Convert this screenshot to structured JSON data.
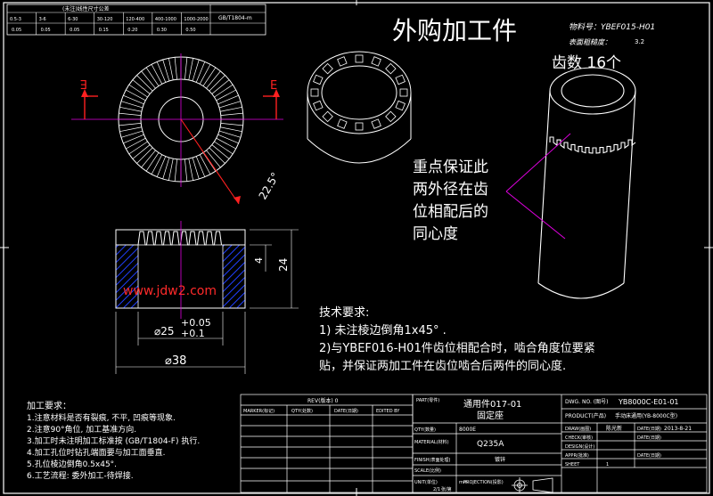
{
  "tolerance_table": {
    "title": "(未注)线性尺寸公差",
    "std": "GB/T1804-m",
    "ranges": [
      "0.5-3",
      "3-6",
      "6-30",
      "30-120",
      "120-400",
      "400-1000",
      "1000-2000"
    ],
    "values": [
      "0.05",
      "0.05",
      "0.05",
      "0.15",
      "0.20",
      "0.30",
      "0.50"
    ]
  },
  "title_main": "外购加工件",
  "code_line": "物料号：YBEF015-H01",
  "roughness_line": "表面粗糙度：",
  "roughness_val": "3.2",
  "teeth_label": "齿数 16个",
  "section_E_left": "E",
  "section_E_right": "E",
  "angle_label": "22.5°",
  "dims": {
    "d25": "⌀25",
    "tol_up": "+0.05",
    "tol_lo": "+0.1",
    "d38": "⌀38",
    "h24": "24",
    "h4": "4"
  },
  "note_lines": [
    "重点保证此",
    "两外径在齿",
    "位相配后的",
    "同心度"
  ],
  "watermark": "www.jdw2.com",
  "tech": {
    "heading": "技术要求:",
    "lines": [
      "1) 未注棱边倒角1x45° .",
      "2)与YBEF016-H01件齿位相配合时，啮合角度位要紧",
      "贴，并保证两加工件在齿位啮合后两件的同心度."
    ]
  },
  "process": {
    "heading": "加工要求：",
    "lines": [
      "1.注意材料是否有裂痕, 不平, 凹痕等现象.",
      "2.注意90°角位, 加工基准方向.",
      "3.加工时未注明加工标准按 (GB/T1804-F) 执行.",
      "4.加工孔位时钻孔端面要与加工面垂直.",
      "5.孔位棱边倒角0.5x45°.",
      "6.工艺流程: 委外加工-待焊接."
    ]
  },
  "rev_block": {
    "title": "REV(版本) 0",
    "cols": [
      "MARKER(标记)",
      "QTY(处数)",
      "DATE(日期)",
      "EDITED BY"
    ]
  },
  "title_block": {
    "part_label": "PART(零件)",
    "part_name1": "通用件017-01",
    "part_name2": "固定座",
    "dwg_label": "DWG. NO. (图号)",
    "dwg_no": "YB8000C-E01-01",
    "product_label": "PRODUCT(产品)",
    "product_name": "手动床通用(YB-8000C型)",
    "qty_label": "QTY(数量)",
    "qty_val": "8000E",
    "material_label": "MATERIAL(材料)",
    "material": "Q235A",
    "finish_label": "FINISH(表面处理)",
    "finish": "镀锌",
    "draw_label": "DRAW(画图)",
    "drawer": "陈光新",
    "date1_label": "DATE(日期)",
    "date1": "2013-8-21",
    "check_label": "CHECK(审核)",
    "design_label": "DESIGN(设计)",
    "appr_label": "APPR(批准)",
    "date_label": "DATE(日期)",
    "scale_label": "SCALE(比例)",
    "scale_val": "2/1",
    "sheet_label": "SHEET",
    "sheet_val": "1",
    "proj_label": "PROJECTION(投影)",
    "unit_label": "UNIT(单位)",
    "unit_val": "mm",
    "total_label": "张/第"
  },
  "colors": {
    "bg": "#000000",
    "line": "#ffffff",
    "red": "#ff2020",
    "magenta": "#e000e0",
    "blue": "#2040ff",
    "watermark": "#ff2a2a"
  }
}
